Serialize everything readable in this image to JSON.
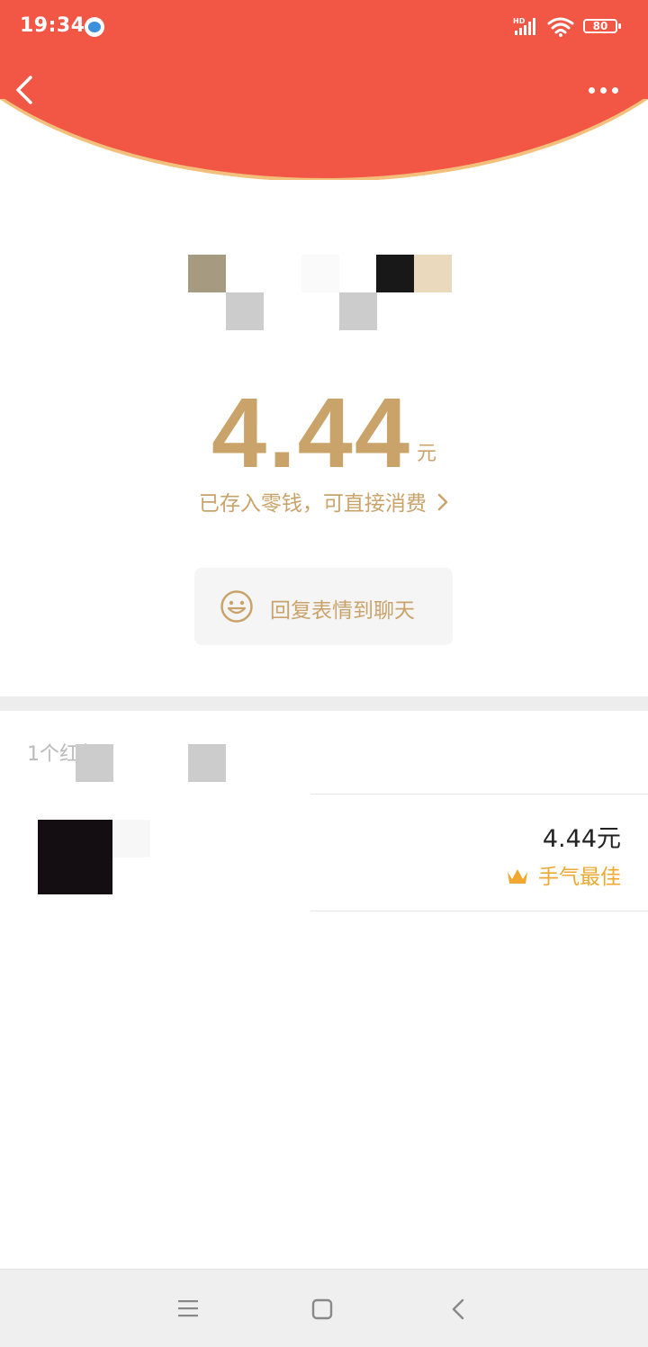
{
  "status_bar": {
    "time": "19:34",
    "network_label": "HD",
    "battery": "80"
  },
  "header": {
    "back_icon": "chevron-left-icon",
    "more_icon": "more-dots-icon",
    "color": "#f25645"
  },
  "envelope": {
    "amount": "4.44",
    "currency_unit": "元",
    "stored_note": "已存入零钱，可直接消费",
    "reply_button_label": "回复表情到聊天",
    "accent_color": "#c9a36a"
  },
  "receivers": {
    "summary": "1个红包",
    "items": [
      {
        "amount": "4.44元",
        "badge": "手气最佳",
        "badge_icon": "crown-icon"
      }
    ]
  },
  "navbar": {
    "icons": [
      "menu-icon",
      "home-icon",
      "back-icon"
    ]
  }
}
